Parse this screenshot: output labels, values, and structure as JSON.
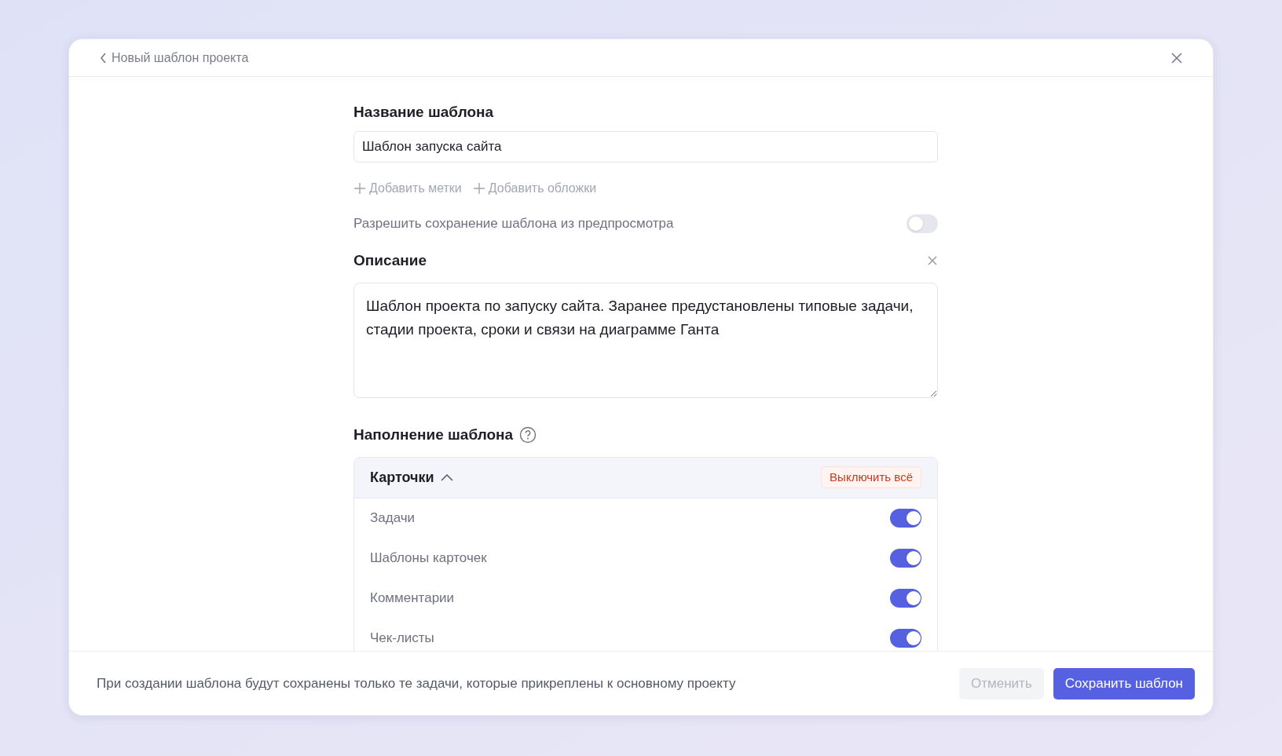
{
  "window": {
    "title": "Новый шаблон проекта"
  },
  "name_field": {
    "label": "Название шаблона",
    "value": "Шаблон запуска сайта"
  },
  "add_links": [
    "Добавить метки",
    "Добавить обложки"
  ],
  "allow_preview": {
    "label": "Разрешить сохранение шаблона из предпросмотра",
    "on": false
  },
  "description": {
    "label": "Описание",
    "value": "Шаблон проекта по запуску сайта. Заранее предустановлены типовые задачи, стадии проекта, сроки и связи на диаграмме Ганта"
  },
  "content": {
    "label": "Наполнение шаблона",
    "group": {
      "title": "Карточки",
      "expanded": true,
      "action": "Выключить всё",
      "items": [
        {
          "label": "Задачи",
          "on": true
        },
        {
          "label": "Шаблоны карточек",
          "on": true
        },
        {
          "label": "Комментарии",
          "on": true
        },
        {
          "label": "Чек-листы",
          "on": true
        }
      ]
    }
  },
  "footer": {
    "note": "При создании шаблона будут сохранены только те задачи, которые прикреплены к основному проекту",
    "buttons": [
      {
        "kind": "secondary",
        "label": "Отменить",
        "disabled": true
      },
      {
        "kind": "primary",
        "label": "Сохранить шаблон",
        "disabled": false
      }
    ]
  }
}
